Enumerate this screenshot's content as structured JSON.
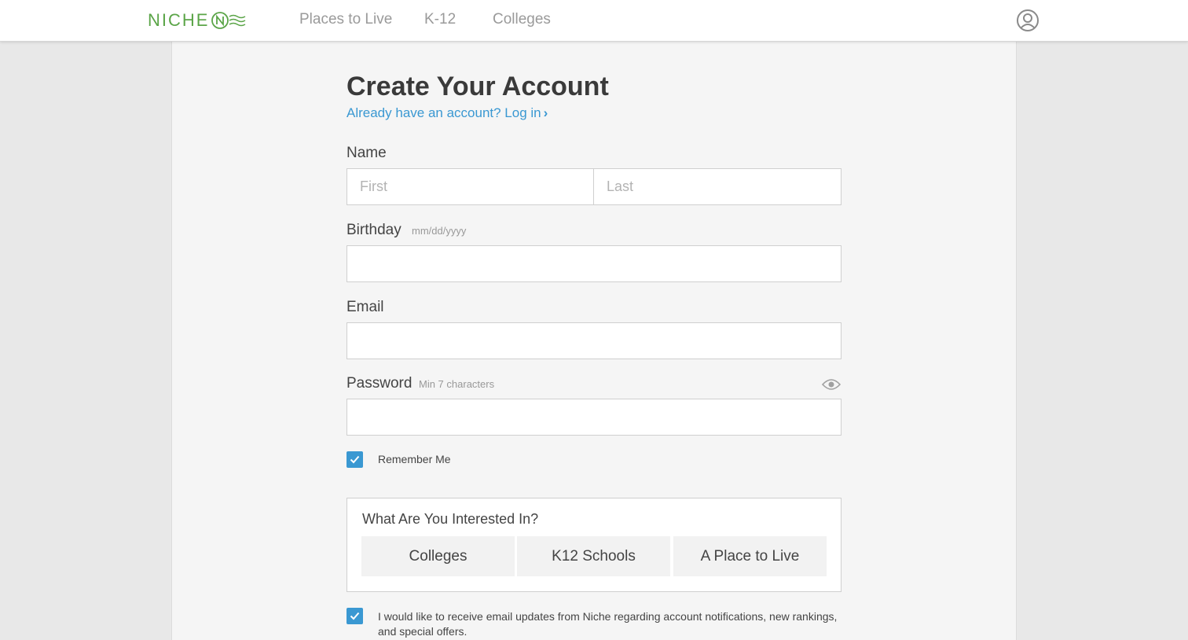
{
  "brand": {
    "logo_text": "NICHE",
    "accent_color": "#5ba548",
    "link_color": "#3a98d2"
  },
  "nav": {
    "links": [
      "Places to Live",
      "K-12",
      "Colleges"
    ],
    "user_icon": "user-circle-icon"
  },
  "form": {
    "title": "Create Your Account",
    "login_prompt": "Already have an account? Log in",
    "login_chevron": "›",
    "name_label": "Name",
    "first_placeholder": "First",
    "last_placeholder": "Last",
    "birthday_label": "Birthday",
    "birthday_hint": "mm/dd/yyyy",
    "email_label": "Email",
    "password_label": "Password",
    "password_hint": "Min 7 characters",
    "password_toggle_icon": "eye-icon",
    "remember_label": "Remember Me",
    "remember_checked": true,
    "interest_title": "What Are You Interested In?",
    "interests": [
      "Colleges",
      "K12 Schools",
      "A Place to Live"
    ],
    "updates_label": "I would like to receive email updates from Niche regarding account notifications, new rankings, and special offers.",
    "updates_checked": true
  }
}
